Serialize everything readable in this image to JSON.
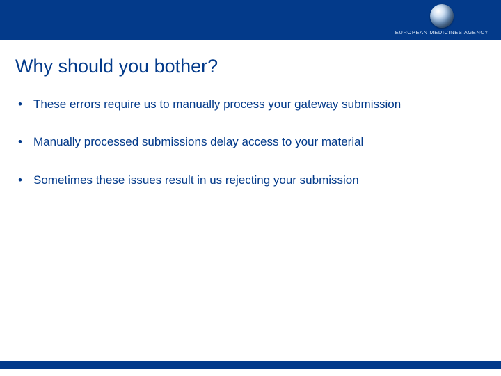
{
  "brand": {
    "logo_name": "ema-globe",
    "text": "EUROPEAN MEDICINES AGENCY"
  },
  "title": "Why should you bother?",
  "bullets": [
    "These errors require us to manually process your gateway submission",
    "Manually processed submissions delay access to your material",
    "Sometimes these issues result in us rejecting your submission"
  ]
}
